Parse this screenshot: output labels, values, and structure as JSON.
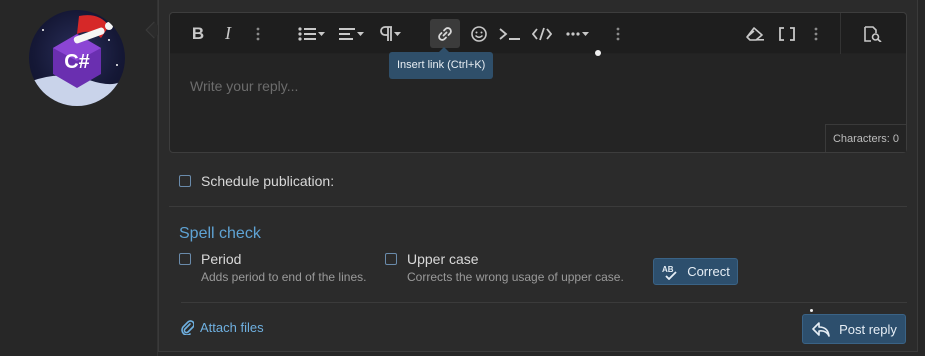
{
  "editor": {
    "placeholder": "Write your reply...",
    "characters_label": "Characters: 0",
    "tooltip": "Insert link (Ctrl+K)",
    "toolbar": [
      {
        "name": "bold-icon",
        "label": "B"
      },
      {
        "name": "italic-icon",
        "label": "I"
      },
      {
        "name": "more-vertical-icon"
      },
      {
        "name": "list-icon"
      },
      {
        "name": "align-icon"
      },
      {
        "name": "paragraph-icon"
      },
      {
        "name": "link-icon",
        "active": true
      },
      {
        "name": "smiley-icon"
      },
      {
        "name": "terminal-icon"
      },
      {
        "name": "code-icon"
      },
      {
        "name": "more-horizontal-icon"
      },
      {
        "name": "more-vertical-icon"
      },
      {
        "name": "eraser-icon"
      },
      {
        "name": "brackets-icon"
      },
      {
        "name": "more-vertical-icon"
      },
      {
        "name": "preview-icon"
      }
    ]
  },
  "schedule": {
    "label": "Schedule publication:"
  },
  "spell_check": {
    "title": "Spell check",
    "options": [
      {
        "label": "Period",
        "desc": "Adds period to end of the lines."
      },
      {
        "label": "Upper case",
        "desc": "Corrects the wrong usage of upper case."
      }
    ],
    "correct_label": "Correct",
    "correct_icon_text": "AB"
  },
  "footer": {
    "attach_label": "Attach files",
    "post_label": "Post reply"
  },
  "avatar_text": "C#",
  "colors": {
    "accent": "#5fa3d4",
    "button": "#2d4f6d",
    "background": "#272727",
    "panel": "#2b2b2b"
  }
}
